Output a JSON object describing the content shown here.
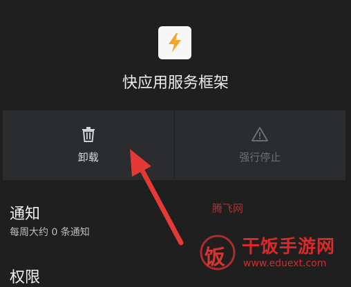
{
  "app": {
    "name": "快应用服务框架",
    "icon": "lightning-bolt-icon"
  },
  "actions": {
    "uninstall_label": "卸载",
    "force_stop_label": "强行停止"
  },
  "notifications": {
    "title": "通知",
    "summary": "每周大约 0 条通知"
  },
  "permissions": {
    "title": "权限"
  },
  "watermark": {
    "top_text": "腾飞网",
    "brand_glyph": "饭",
    "brand_text": "干饭手游网",
    "url": "www.eduext.com"
  },
  "colors": {
    "background": "#1f1f1f",
    "button_bg": "#2b2c2e",
    "icon_bolt": "#f5a623",
    "arrow": "#e53935"
  }
}
